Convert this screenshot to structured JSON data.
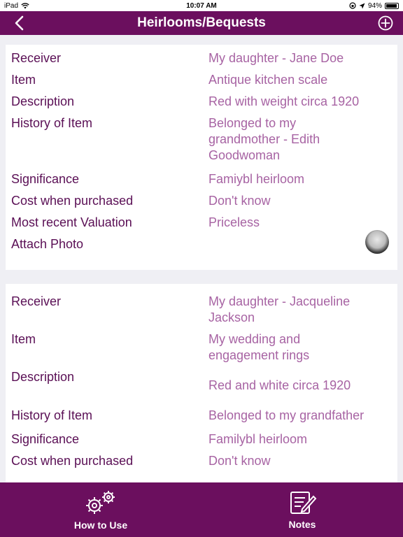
{
  "status_bar": {
    "device": "iPad",
    "time": "10:07 AM",
    "battery": "94%"
  },
  "nav": {
    "title": "Heirlooms/Bequests",
    "back_icon": "chevron-left-icon",
    "add_icon": "plus-circle-icon"
  },
  "bequests": [
    {
      "receiver_label": "Receiver",
      "receiver": "My daughter - Jane Doe",
      "item_label": "Item",
      "item": "Antique kitchen scale",
      "description_label": "Description",
      "description": "Red with weight circa 1920",
      "history_label": "History of Item",
      "history": "Belonged to my grandmother - Edith Goodwoman",
      "significance_label": "Significance",
      "significance": "Famiybl heirloom",
      "cost_label": "Cost when purchased",
      "cost": "Don't know",
      "valuation_label": "Most recent Valuation",
      "valuation": "Priceless",
      "photo_label": "Attach Photo"
    },
    {
      "receiver_label": "Receiver",
      "receiver": "My daughter - Jacqueline Jackson",
      "item_label": "Item",
      "item": "My wedding and engagement rings",
      "description_label": "Description",
      "description": "Red and white circa 1920",
      "history_label": "History of Item",
      "history": "Belonged to my grandfather",
      "significance_label": "Significance",
      "significance": "Familybl heirloom",
      "cost_label": "Cost when purchased",
      "cost": "Don't know"
    }
  ],
  "tab_bar": {
    "how_to_use": "How to Use",
    "notes": "Notes"
  },
  "colors": {
    "brand": "#6b0f5e",
    "label": "#5a0f55",
    "value": "#a763a3",
    "background": "#efeff4"
  }
}
